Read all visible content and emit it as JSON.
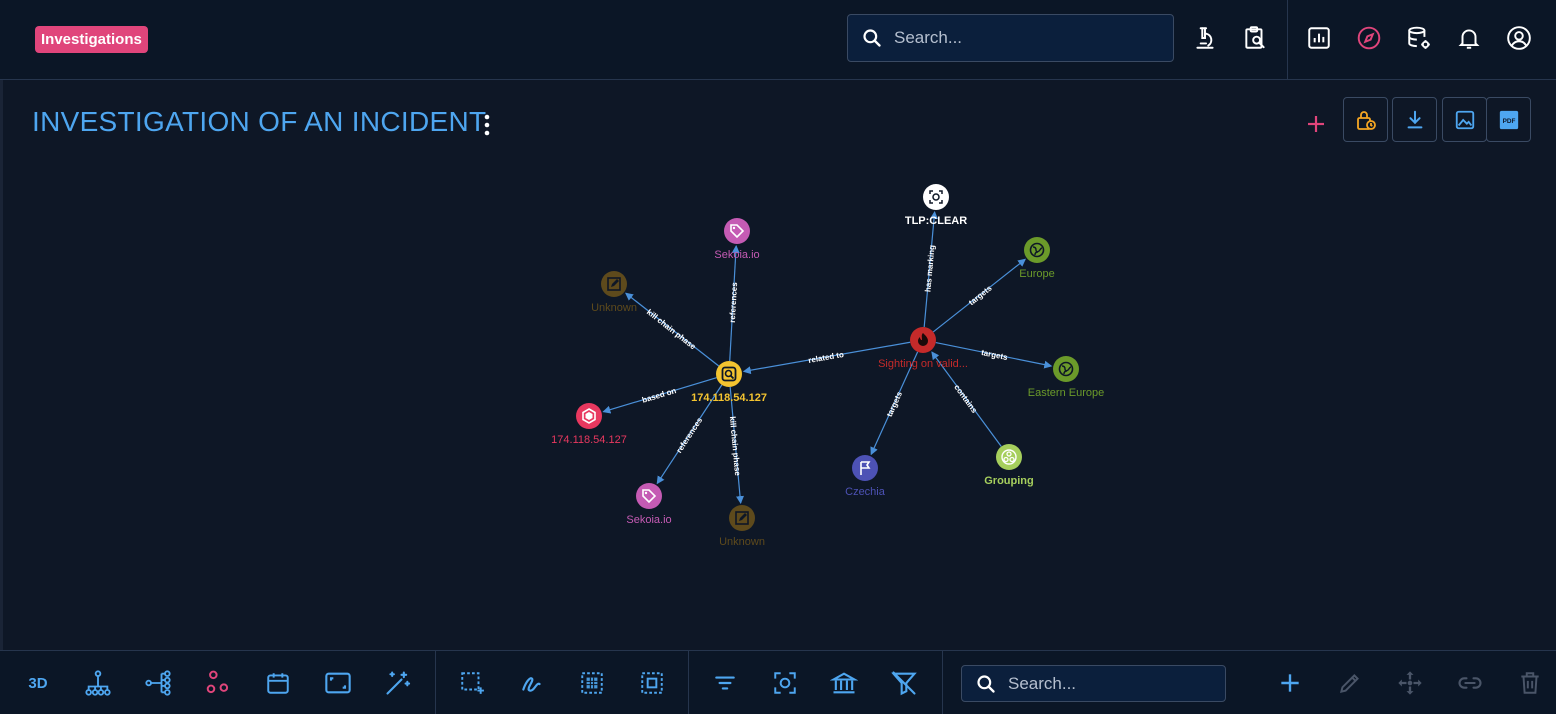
{
  "header": {
    "badge_label": "Investigations",
    "search_placeholder": "Search..."
  },
  "page": {
    "title": "INVESTIGATION OF AN INCIDENT"
  },
  "graph": {
    "nodes": [
      {
        "id": "tlp",
        "label": "TLP:CLEAR",
        "color": "#ffffff",
        "label_color": "#ffffff",
        "icon": "marking-icon",
        "bold": true
      },
      {
        "id": "sekoia1",
        "label": "Sekoia.io",
        "color": "#c55bb4",
        "label_color": "#c55bb4",
        "icon": "tag-icon"
      },
      {
        "id": "unknown1",
        "label": "Unknown",
        "color": "#5e4a1c",
        "label_color": "#5e4a1c",
        "icon": "edit-box-icon"
      },
      {
        "id": "ip_obs",
        "label": "174.118.54.127",
        "color": "#f4c430",
        "label_color": "#f4c430",
        "icon": "observable-icon",
        "bold": true
      },
      {
        "id": "ip_ind",
        "label": "174.118.54.127",
        "color": "#e8385f",
        "label_color": "#e8385f",
        "icon": "indicator-icon"
      },
      {
        "id": "sekoia2",
        "label": "Sekoia.io",
        "color": "#c55bb4",
        "label_color": "#c55bb4",
        "icon": "tag-icon"
      },
      {
        "id": "unknown2",
        "label": "Unknown",
        "color": "#5e4a1c",
        "label_color": "#5e4a1c",
        "icon": "edit-box-icon"
      },
      {
        "id": "sighting",
        "label": "Sighting on valid...",
        "color": "#c42a2a",
        "label_color": "#c42a2a",
        "icon": "fire-icon"
      },
      {
        "id": "europe",
        "label": "Europe",
        "color": "#6b9a2a",
        "label_color": "#6b9a2a",
        "icon": "globe-icon"
      },
      {
        "id": "eeurope",
        "label": "Eastern Europe",
        "color": "#6b9a2a",
        "label_color": "#6b9a2a",
        "icon": "globe-icon"
      },
      {
        "id": "czechia",
        "label": "Czechia",
        "color": "#4d52b5",
        "label_color": "#4d52b5",
        "icon": "flag-icon"
      },
      {
        "id": "grouping",
        "label": "Grouping",
        "color": "#a6cf5d",
        "label_color": "#a6cf5d",
        "icon": "grouping-icon",
        "bold": true
      }
    ],
    "edges": [
      {
        "from": "sighting",
        "to": "tlp",
        "label": "has marking"
      },
      {
        "from": "sighting",
        "to": "europe",
        "label": "targets"
      },
      {
        "from": "sighting",
        "to": "eeurope",
        "label": "targets"
      },
      {
        "from": "sighting",
        "to": "czechia",
        "label": "targets"
      },
      {
        "from": "grouping",
        "to": "sighting",
        "label": "contains"
      },
      {
        "from": "sighting",
        "to": "ip_obs",
        "label": "related to"
      },
      {
        "from": "ip_obs",
        "to": "sekoia1",
        "label": "references"
      },
      {
        "from": "ip_obs",
        "to": "unknown1",
        "label": "kill chain phase"
      },
      {
        "from": "ip_obs",
        "to": "ip_ind",
        "label": "based on"
      },
      {
        "from": "ip_obs",
        "to": "sekoia2",
        "label": "references"
      },
      {
        "from": "ip_obs",
        "to": "unknown2",
        "label": "kill chain phase"
      }
    ]
  },
  "bottombar": {
    "three_d_label": "3D",
    "search_placeholder": "Search..."
  },
  "colors": {
    "accent": "#4ea6f0",
    "pink": "#e0457b",
    "edge": "#4a90d9",
    "lock": "#f5a623"
  }
}
